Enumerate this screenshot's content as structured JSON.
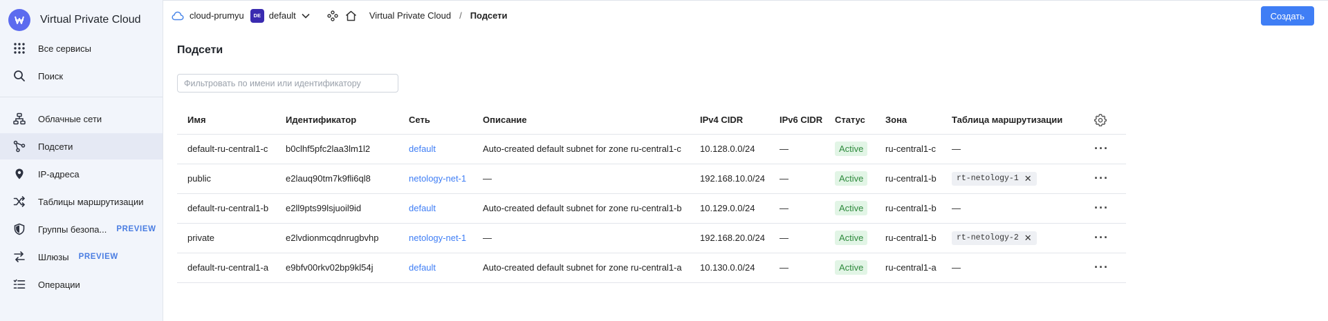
{
  "sidebar": {
    "title": "Virtual Private Cloud",
    "logo_icon": "vpc-logo-icon",
    "top_items": [
      {
        "label": "Все сервисы",
        "icon": "grid-icon"
      },
      {
        "label": "Поиск",
        "icon": "search-icon"
      }
    ],
    "items": [
      {
        "label": "Облачные сети",
        "icon": "network-icon"
      },
      {
        "label": "Подсети",
        "icon": "subnet-icon",
        "active": true
      },
      {
        "label": "IP-адреса",
        "icon": "location-pin-icon"
      },
      {
        "label": "Таблицы маршрутизации",
        "icon": "route-shuffle-icon"
      },
      {
        "label": "Группы безопа...",
        "icon": "shield-icon",
        "badge": "PREVIEW"
      },
      {
        "label": "Шлюзы",
        "icon": "gateway-icon",
        "badge": "PREVIEW"
      },
      {
        "label": "Операции",
        "icon": "list-icon"
      }
    ]
  },
  "topbar": {
    "cloud": "cloud-prumyu",
    "folder_badge": "DE",
    "folder": "default",
    "breadcrumb": [
      "Virtual Private Cloud",
      "Подсети"
    ],
    "breadcrumb_sep": "/",
    "create_label": "Создать"
  },
  "main": {
    "title": "Подсети",
    "filter_placeholder": "Фильтровать по имени или идентификатору",
    "columns": [
      "Имя",
      "Идентификатор",
      "Сеть",
      "Описание",
      "IPv4 CIDR",
      "IPv6 CIDR",
      "Статус",
      "Зона",
      "Таблица маршрутизации"
    ],
    "rows": [
      {
        "name": "default-ru-central1-c",
        "id": "b0clhf5pfc2laa3lm1l2",
        "network": "default",
        "description": "Auto-created default subnet for zone ru-central1-c",
        "ipv4": "10.128.0.0/24",
        "ipv6": "—",
        "status": "Active",
        "zone": "ru-central1-c",
        "route_table": "—",
        "route_chip": false
      },
      {
        "name": "public",
        "id": "e2lauq90tm7k9fli6ql8",
        "network": "netology-net-1",
        "description": "—",
        "ipv4": "192.168.10.0/24",
        "ipv6": "—",
        "status": "Active",
        "zone": "ru-central1-b",
        "route_table": "rt-netology-1",
        "route_chip": true
      },
      {
        "name": "default-ru-central1-b",
        "id": "e2ll9pts99lsjuoil9id",
        "network": "default",
        "description": "Auto-created default subnet for zone ru-central1-b",
        "ipv4": "10.129.0.0/24",
        "ipv6": "—",
        "status": "Active",
        "zone": "ru-central1-b",
        "route_table": "—",
        "route_chip": false
      },
      {
        "name": "private",
        "id": "e2lvdionmcqdnrugbvhp",
        "network": "netology-net-1",
        "description": "—",
        "ipv4": "192.168.20.0/24",
        "ipv6": "—",
        "status": "Active",
        "zone": "ru-central1-b",
        "route_table": "rt-netology-2",
        "route_chip": true
      },
      {
        "name": "default-ru-central1-a",
        "id": "e9bfv00rkv02bp9kl54j",
        "network": "default",
        "description": "Auto-created default subnet for zone ru-central1-a",
        "ipv4": "10.130.0.0/24",
        "ipv6": "—",
        "status": "Active",
        "zone": "ru-central1-a",
        "route_table": "—",
        "route_chip": false
      }
    ]
  },
  "colors": {
    "accent": "#3f7ef5",
    "logo": "#5c6bef",
    "status_bg": "#e2f5e6",
    "status_fg": "#2f8a3d",
    "folder_badge": "#3a2bb0"
  }
}
